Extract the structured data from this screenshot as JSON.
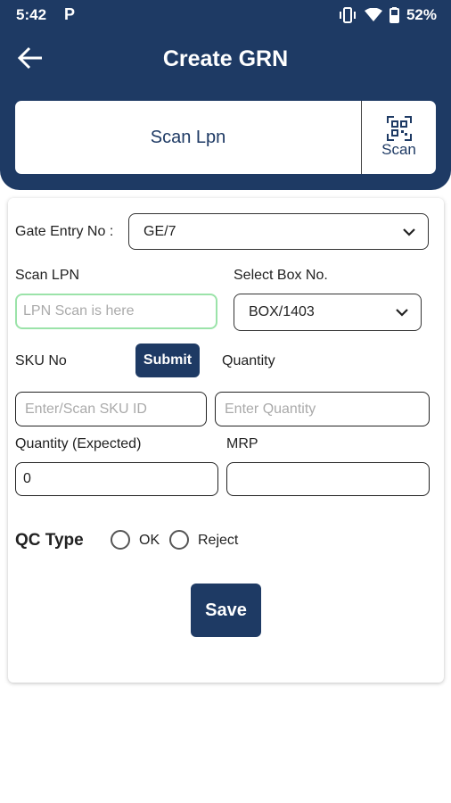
{
  "status_bar": {
    "time": "5:42",
    "p_icon": "P",
    "battery": "52%"
  },
  "appbar": {
    "title": "Create GRN"
  },
  "scan_bar": {
    "label": "Scan Lpn",
    "button": "Scan"
  },
  "form": {
    "gate_entry": {
      "label": "Gate Entry No :",
      "value": "GE/7"
    },
    "scan_lpn": {
      "label": "Scan LPN",
      "placeholder": "LPN Scan is here"
    },
    "select_box": {
      "label": "Select Box No.",
      "value": "BOX/1403"
    },
    "sku": {
      "label": "SKU No",
      "submit": "Submit",
      "placeholder": "Enter/Scan SKU ID"
    },
    "quantity": {
      "label": "Quantity",
      "placeholder": "Enter Quantity"
    },
    "quantity_expected": {
      "label": "Quantity (Expected)",
      "value": "0"
    },
    "mrp": {
      "label": "MRP",
      "value": ""
    },
    "qc_type": {
      "label": "QC Type",
      "options": [
        "OK",
        "Reject"
      ]
    },
    "save": "Save"
  },
  "colors": {
    "primary": "#1e3a64",
    "focus_border": "#9be3a9"
  },
  "icons": [
    "back-arrow-icon",
    "qr-scan-icon",
    "vibrate-icon",
    "wifi-icon",
    "battery-icon",
    "chevron-down-icon"
  ]
}
